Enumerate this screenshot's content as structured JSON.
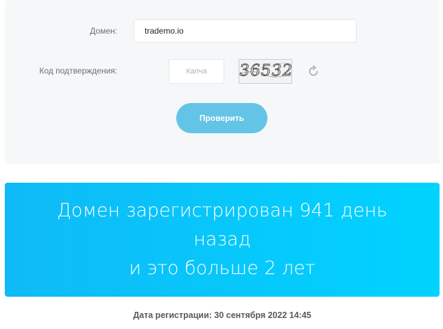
{
  "form": {
    "domain_label": "Домен:",
    "domain_value": "trademo.io",
    "captcha_label": "Код подтверждения:",
    "captcha_placeholder": "Капча",
    "captcha_image_text": "36532",
    "refresh_icon": "refresh-icon",
    "check_button_label": "Проверить"
  },
  "result": {
    "line1": "Домен зарегистрирован 941 день",
    "line2": "назад",
    "line3": "и это больше 2 лет"
  },
  "registration": {
    "text": "Дата регистрации: 30 сентября 2022 14:45"
  },
  "colors": {
    "panel_bg": "#f5f7f8",
    "button_bg": "#64c4e6",
    "result_gradient_start": "#0fbaf6",
    "result_gradient_end": "#00d3ff"
  }
}
